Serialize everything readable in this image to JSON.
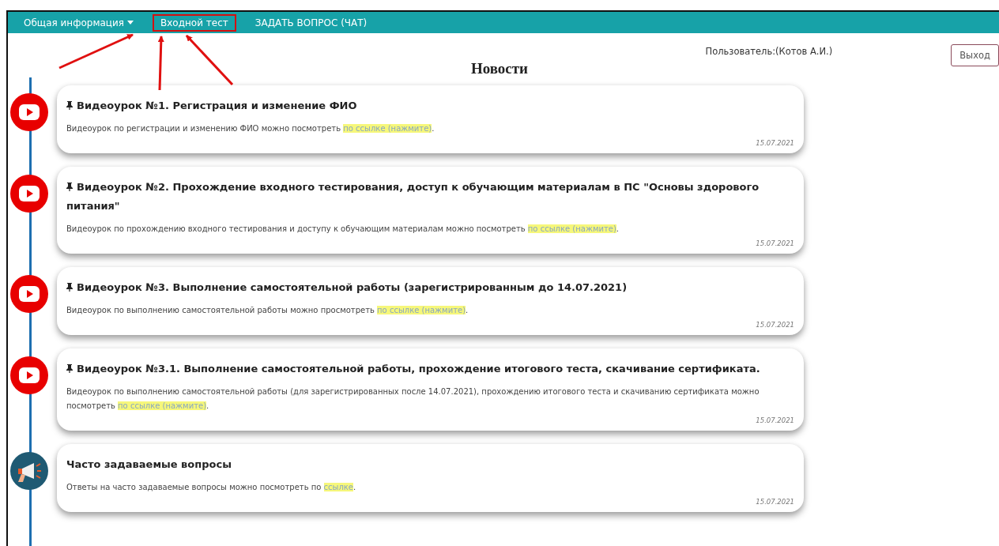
{
  "nav": {
    "items": [
      {
        "label": "Общая информация",
        "kind": "dropdown",
        "highlighted": false
      },
      {
        "label": "Входной тест",
        "kind": "link",
        "highlighted": true
      },
      {
        "label": "ЗАДАТЬ ВОПРОС (ЧАТ)",
        "kind": "link",
        "highlighted": false
      }
    ]
  },
  "user": "Пользователь:(Котов А.И.)",
  "logout": "Выход",
  "title": "Новости",
  "news": [
    {
      "kind": "video",
      "pinned": true,
      "title": "Видеоурок №1. Регистрация и изменение ФИО",
      "text": "Видеоурок по регистрации и изменению ФИО можно посмотреть ",
      "link": "по ссылке (нажмите)",
      "end": ".",
      "date": "15.07.2021"
    },
    {
      "kind": "video",
      "pinned": true,
      "title": "Видеоурок №2. Прохождение входного тестирования, доступ к обучающим материалам в ПС \"Основы здорового питания\"",
      "text": "Видеоурок по прохождению входного тестирования и доступу к обучающим материалам можно посмотреть ",
      "link": "по ссылке (нажмите)",
      "end": ".",
      "date": "15.07.2021"
    },
    {
      "kind": "video",
      "pinned": true,
      "title": "Видеоурок №3. Выполнение самостоятельной работы (зарегистрированным до 14.07.2021)",
      "text": "Видеоурок по выполнению самостоятельной работы можно просмотреть ",
      "link": "по ссылке (нажмите)",
      "end": ".",
      "date": "15.07.2021"
    },
    {
      "kind": "video",
      "pinned": true,
      "title": "Видеоурок №3.1. Выполнение самостоятельной работы, прохождение итогового теста, скачивание сертификата.",
      "text": "Видеоурок по выполнению самостоятельной работы (для зарегистрированных после 14.07.2021), прохождению итогового теста и скачиванию сертификата можно посмотреть ",
      "link": "по ссылке (нажмите)",
      "end": ".",
      "date": "15.07.2021"
    },
    {
      "kind": "megaphone",
      "pinned": false,
      "title": "Часто задаваемые вопросы",
      "text": "Ответы на часто задаваемые вопросы можно посмотреть по ",
      "link": "ссылке",
      "end": ".",
      "date": "15.07.2021"
    }
  ]
}
